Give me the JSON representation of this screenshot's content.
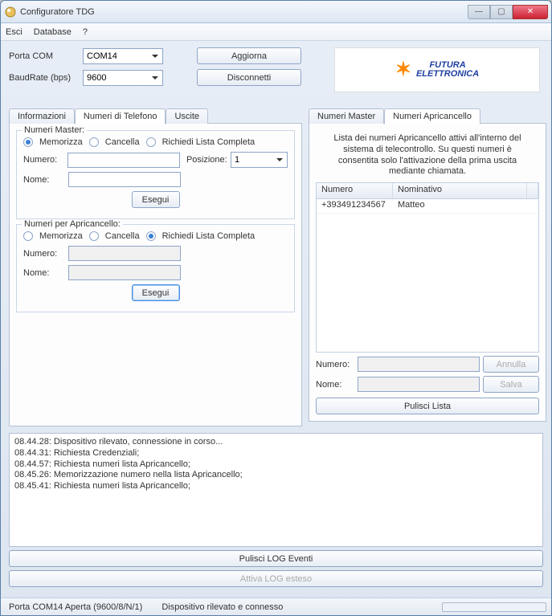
{
  "window": {
    "title": "Configuratore TDG"
  },
  "menu": {
    "esci": "Esci",
    "database": "Database",
    "help": "?"
  },
  "conn": {
    "porta_lbl": "Porta COM",
    "porta_val": "COM14",
    "baud_lbl": "BaudRate (bps)",
    "baud_val": "9600",
    "aggiorna": "Aggiorna",
    "disconnetti": "Disconnetti"
  },
  "logo": {
    "line1": "FUTURA",
    "line2": "ELETTRONICA"
  },
  "left_tabs": {
    "informazioni": "Informazioni",
    "numeri": "Numeri di Telefono",
    "uscite": "Uscite"
  },
  "master": {
    "legend": "Numeri Master:",
    "memorizza": "Memorizza",
    "cancella": "Cancella",
    "richiedi": "Richiedi Lista Completa",
    "numero_lbl": "Numero:",
    "numero_val": "",
    "nome_lbl": "Nome:",
    "nome_val": "",
    "posizione_lbl": "Posizione:",
    "posizione_val": "1",
    "esegui": "Esegui"
  },
  "apric": {
    "legend": "Numeri per Apricancello:",
    "memorizza": "Memorizza",
    "cancella": "Cancella",
    "richiedi": "Richiedi Lista Completa",
    "numero_lbl": "Numero:",
    "numero_val": "",
    "nome_lbl": "Nome:",
    "nome_val": "",
    "esegui": "Esegui"
  },
  "right_tabs": {
    "master": "Numeri Master",
    "apric": "Numeri Apricancello"
  },
  "right_panel": {
    "desc": "Lista dei numeri Apricancello attivi all'interno del sistema di telecontrollo. Su questi numeri è consentita solo l'attivazione della prima uscita mediante chiamata.",
    "col_numero": "Numero",
    "col_nominativo": "Nominativo",
    "rows": [
      {
        "numero": "+393491234567",
        "nominativo": "Matteo"
      }
    ],
    "numero_lbl": "Numero:",
    "numero_val": "",
    "nome_lbl": "Nome:",
    "nome_val": "",
    "annulla": "Annulla",
    "salva": "Salva",
    "pulisci": "Pulisci Lista"
  },
  "log": {
    "lines": [
      "08.44.28: Dispositivo rilevato, connessione in corso...",
      "08.44.31: Richiesta Credenziali;",
      "08.44.57: Richiesta numeri lista Apricancello;",
      "08.45.26: Memorizzazione numero nella lista Apricancello;",
      "08.45.41: Richiesta numeri lista Apricancello;"
    ],
    "pulisci": "Pulisci LOG Eventi",
    "attiva": "Attiva LOG esteso"
  },
  "status": {
    "porta": "Porta COM14 Aperta (9600/8/N/1)",
    "disp": "Dispositivo rilevato e connesso"
  }
}
